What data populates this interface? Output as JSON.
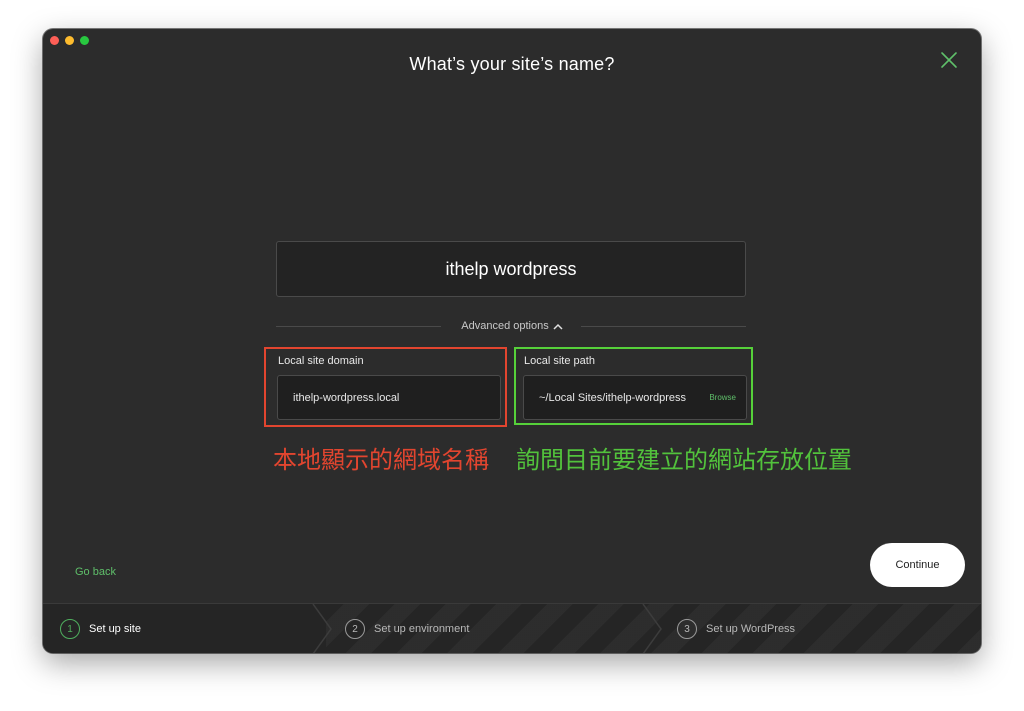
{
  "window": {
    "title": "What’s your site’s name?"
  },
  "form": {
    "site_name_value": "ithelp wordpress",
    "advanced_options_label": "Advanced options",
    "domain": {
      "label": "Local site domain",
      "value": "ithelp-wordpress.local"
    },
    "path": {
      "label": "Local site path",
      "value": "~/Local Sites/ithelp-wordpress",
      "browse_label": "Browse"
    }
  },
  "annotations": {
    "red_note": "本地顯示的網域名稱",
    "green_note": "詢問目前要建立的網站存放位置",
    "red_color": "#e2452f",
    "green_color": "#52c23c"
  },
  "footer": {
    "go_back_label": "Go back",
    "continue_label": "Continue"
  },
  "steps": [
    {
      "number": "1",
      "label": "Set up site",
      "active": true
    },
    {
      "number": "2",
      "label": "Set up environment",
      "active": false
    },
    {
      "number": "3",
      "label": "Set up WordPress",
      "active": false
    }
  ],
  "colors": {
    "accent_green": "#5fbf6a",
    "window_bg": "#2c2c2c"
  },
  "icons": [
    "close-icon",
    "chevron-up-icon"
  ]
}
